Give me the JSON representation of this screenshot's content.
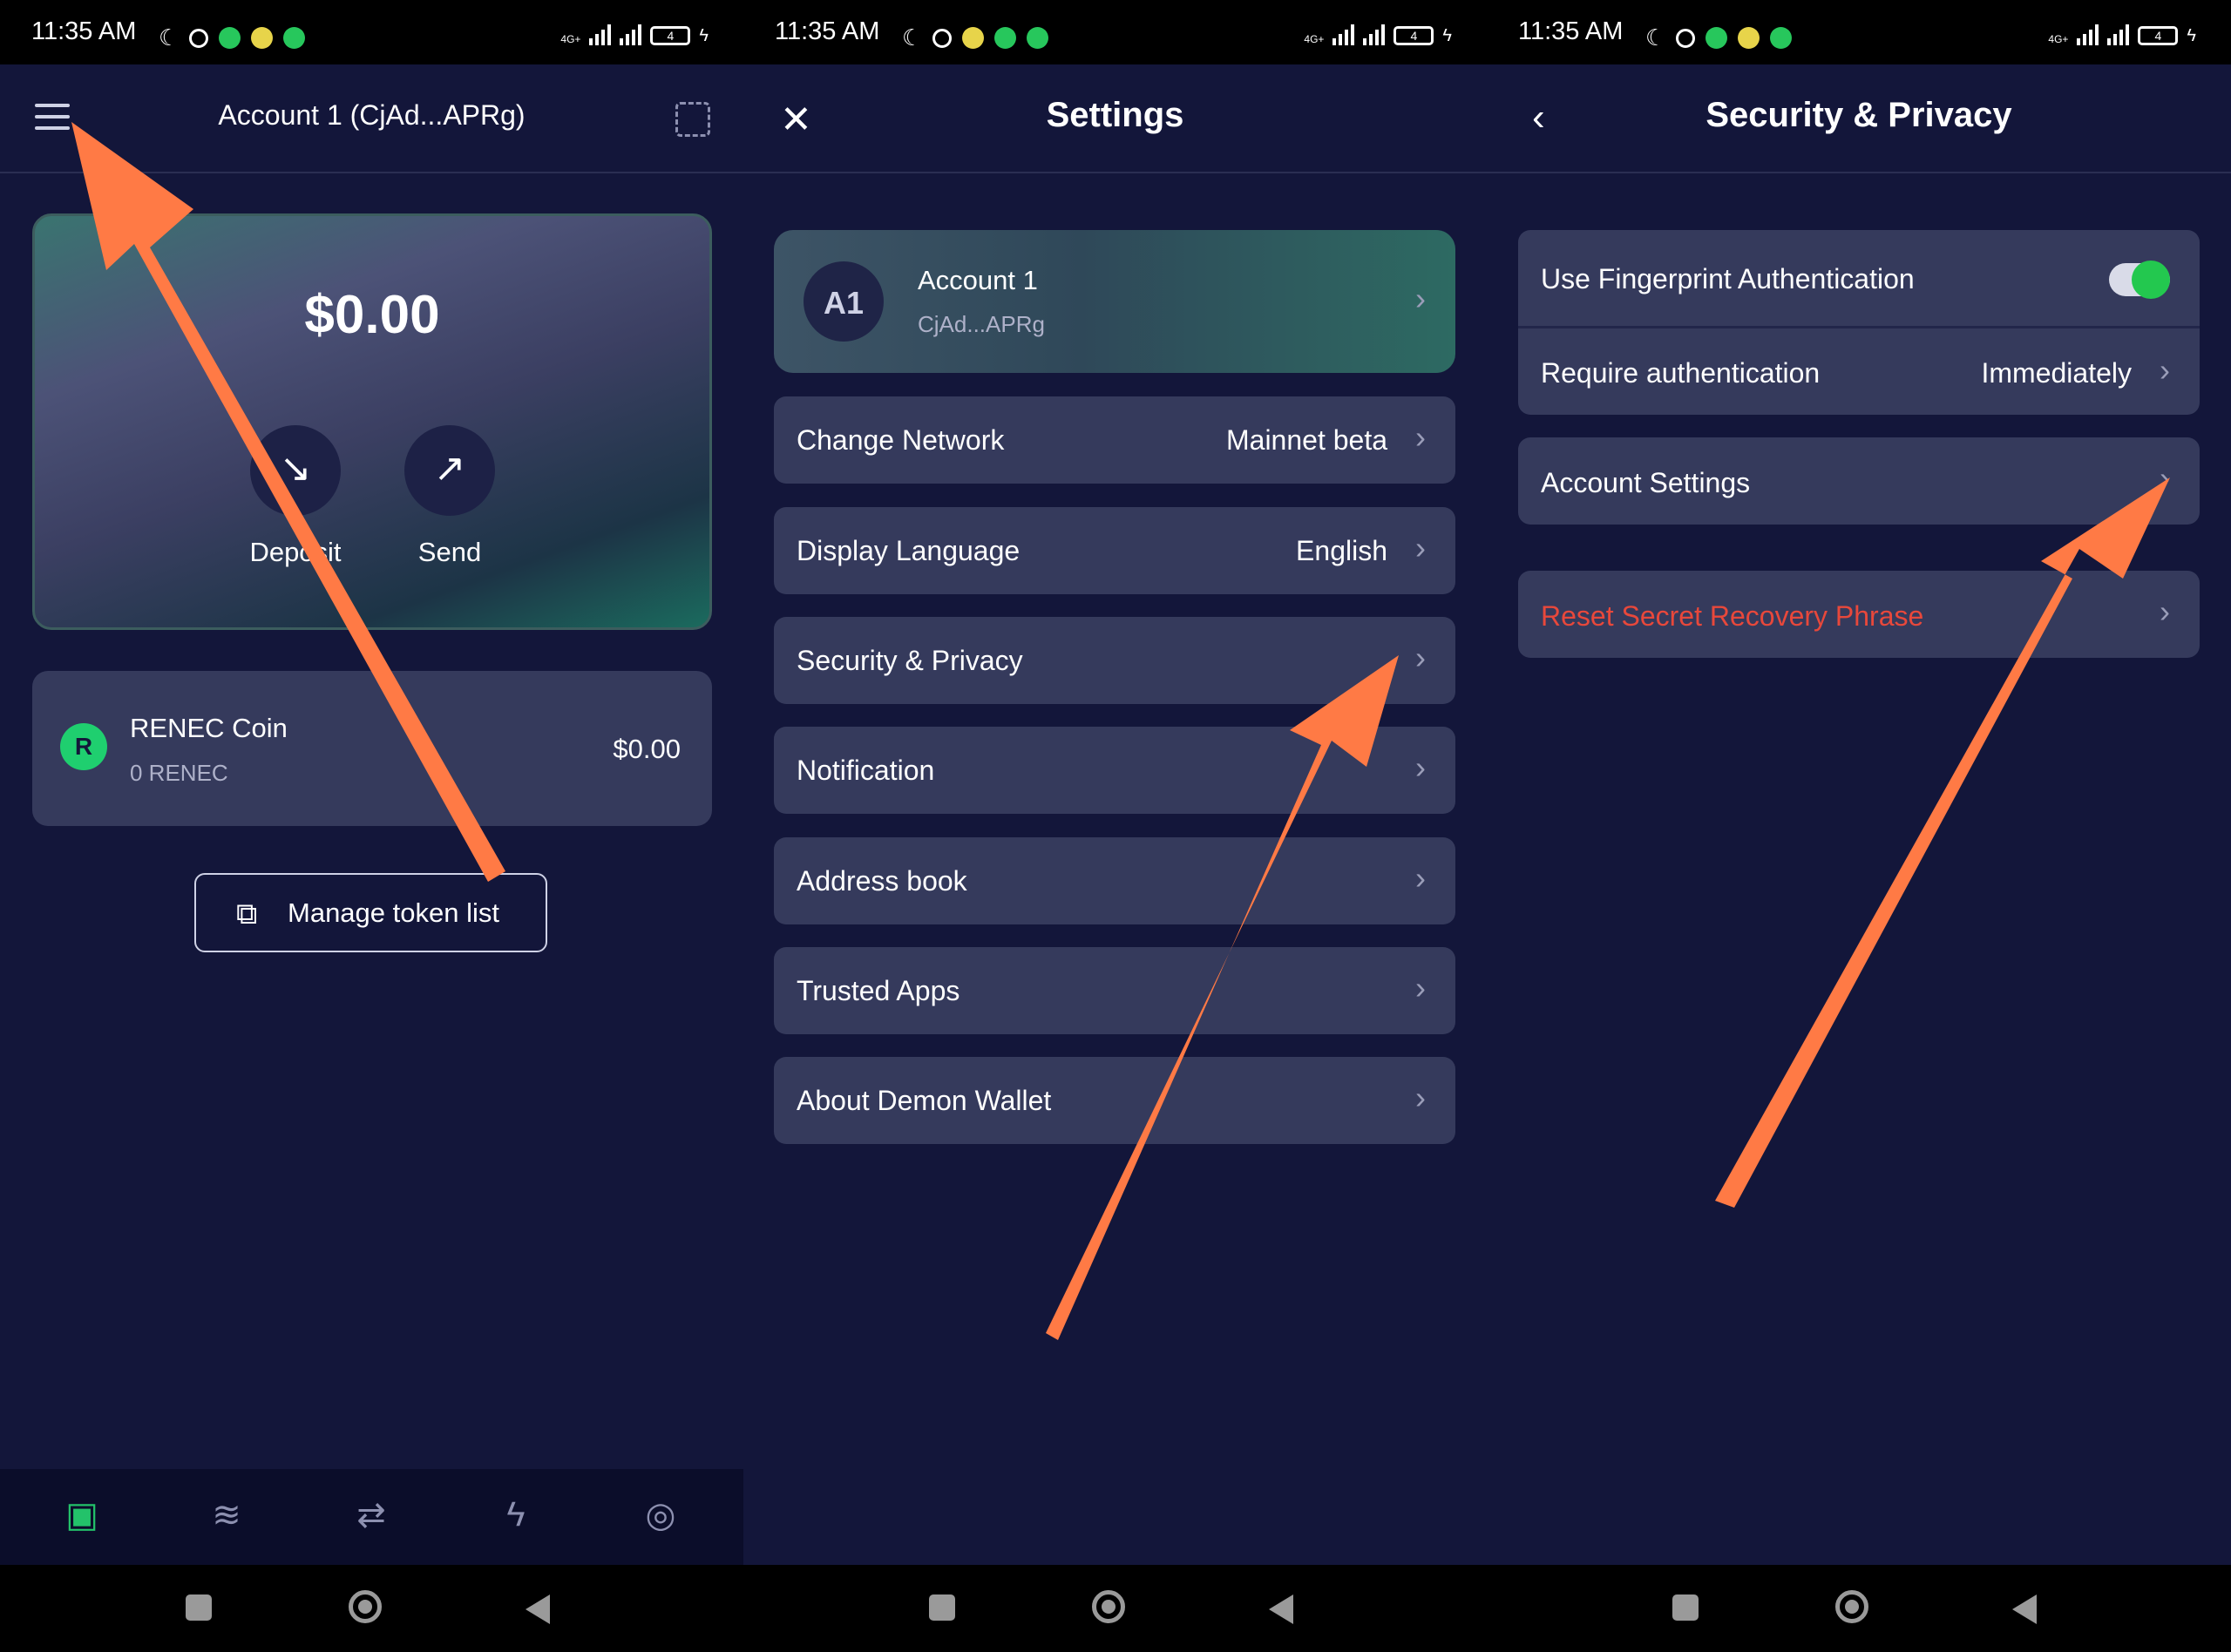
{
  "status_bar": {
    "time": "11:35 AM",
    "network": "4G+",
    "battery": "4"
  },
  "wallet": {
    "header_title": "Account 1 (CjAd...APRg)",
    "balance": "$0.00",
    "deposit_label": "Deposit",
    "send_label": "Send",
    "token": {
      "name": "RENEC Coin",
      "amount": "0 RENEC",
      "value": "$0.00",
      "logo_letter": "R"
    },
    "manage_label": "Manage token list",
    "tabs": [
      "wallet-icon",
      "stack-icon",
      "swap-icon",
      "bolt-icon",
      "globe-icon"
    ]
  },
  "settings": {
    "title": "Settings",
    "account": {
      "avatar": "A1",
      "name": "Account 1",
      "address": "CjAd...APRg"
    },
    "items": [
      {
        "label": "Change Network",
        "value": "Mainnet beta"
      },
      {
        "label": "Display Language",
        "value": "English"
      },
      {
        "label": "Security & Privacy",
        "value": ""
      },
      {
        "label": "Notification",
        "value": ""
      },
      {
        "label": "Address book",
        "value": ""
      },
      {
        "label": "Trusted Apps",
        "value": ""
      },
      {
        "label": "About Demon Wallet",
        "value": ""
      }
    ]
  },
  "security": {
    "title": "Security & Privacy",
    "fingerprint_label": "Use Fingerprint Authentication",
    "fingerprint_enabled": true,
    "require_auth_label": "Require authentication",
    "require_auth_value": "Immediately",
    "account_settings_label": "Account Settings",
    "reset_label": "Reset Secret Recovery Phrase"
  },
  "colors": {
    "background": "#13163a",
    "row": "#353a5c",
    "accent_green": "#23c84f",
    "danger_red": "#e8483b",
    "arrow_orange": "#ff7a45"
  }
}
